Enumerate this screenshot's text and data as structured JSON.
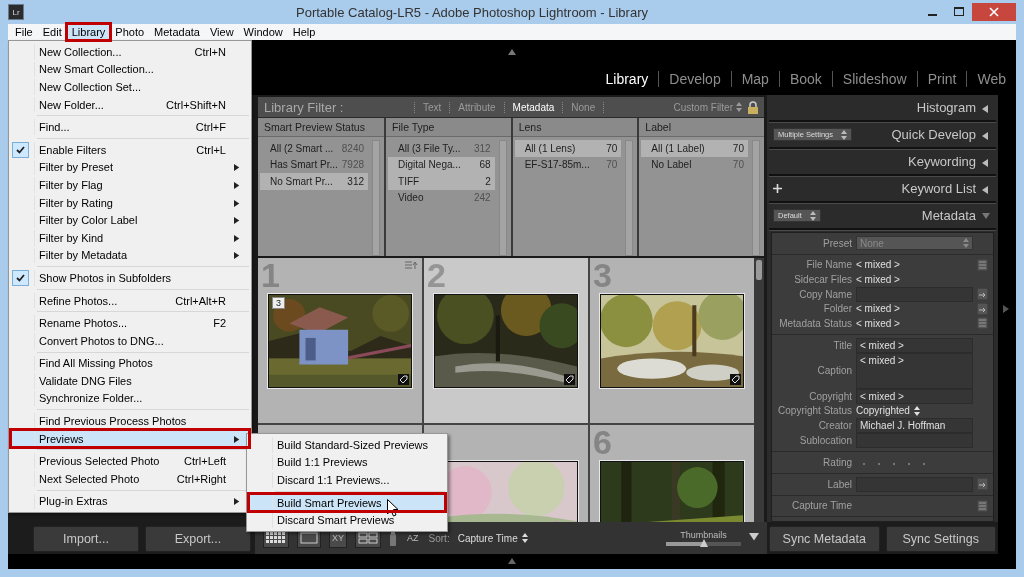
{
  "window": {
    "title": "Portable Catalog-LR5 - Adobe Photoshop Lightroom - Library",
    "app_badge": "Lr"
  },
  "menu_bar": [
    {
      "label": "File",
      "selected": false,
      "highlighted": false
    },
    {
      "label": "Edit",
      "selected": false,
      "highlighted": false
    },
    {
      "label": "Library",
      "selected": true,
      "highlighted": true
    },
    {
      "label": "Photo",
      "selected": false,
      "highlighted": false
    },
    {
      "label": "Metadata",
      "selected": false,
      "highlighted": false
    },
    {
      "label": "View",
      "selected": false,
      "highlighted": false
    },
    {
      "label": "Window",
      "selected": false,
      "highlighted": false
    },
    {
      "label": "Help",
      "selected": false,
      "highlighted": false
    }
  ],
  "modules": [
    {
      "label": "Library",
      "selected": true
    },
    {
      "label": "Develop",
      "selected": false
    },
    {
      "label": "Map",
      "selected": false
    },
    {
      "label": "Book",
      "selected": false
    },
    {
      "label": "Slideshow",
      "selected": false
    },
    {
      "label": "Print",
      "selected": false
    },
    {
      "label": "Web",
      "selected": false
    }
  ],
  "library_menu": [
    {
      "kind": "item",
      "label": "New Collection...",
      "shortcut": "Ctrl+N",
      "checked": false,
      "submenu": false,
      "selected": false,
      "highlighted": false
    },
    {
      "kind": "item",
      "label": "New Smart Collection...",
      "checked": false,
      "submenu": false,
      "selected": false,
      "highlighted": false
    },
    {
      "kind": "item",
      "label": "New Collection Set...",
      "checked": false,
      "submenu": false,
      "selected": false,
      "highlighted": false
    },
    {
      "kind": "item",
      "label": "New Folder...",
      "shortcut": "Ctrl+Shift+N",
      "checked": false,
      "submenu": false,
      "selected": false,
      "highlighted": false
    },
    {
      "kind": "separator"
    },
    {
      "kind": "item",
      "label": "Find...",
      "shortcut": "Ctrl+F",
      "checked": false,
      "submenu": false,
      "selected": false,
      "highlighted": false
    },
    {
      "kind": "separator"
    },
    {
      "kind": "item",
      "label": "Enable Filters",
      "shortcut": "Ctrl+L",
      "checked": true,
      "submenu": false,
      "selected": false,
      "highlighted": false
    },
    {
      "kind": "item",
      "label": "Filter by Preset",
      "checked": false,
      "submenu": true,
      "selected": false,
      "highlighted": false
    },
    {
      "kind": "item",
      "label": "Filter by Flag",
      "checked": false,
      "submenu": true,
      "selected": false,
      "highlighted": false
    },
    {
      "kind": "item",
      "label": "Filter by Rating",
      "checked": false,
      "submenu": true,
      "selected": false,
      "highlighted": false
    },
    {
      "kind": "item",
      "label": "Filter by Color Label",
      "checked": false,
      "submenu": true,
      "selected": false,
      "highlighted": false
    },
    {
      "kind": "item",
      "label": "Filter by Kind",
      "checked": false,
      "submenu": true,
      "selected": false,
      "highlighted": false
    },
    {
      "kind": "item",
      "label": "Filter by Metadata",
      "checked": false,
      "submenu": true,
      "selected": false,
      "highlighted": false
    },
    {
      "kind": "separator"
    },
    {
      "kind": "item",
      "label": "Show Photos in Subfolders",
      "checked": true,
      "submenu": false,
      "selected": false,
      "highlighted": false
    },
    {
      "kind": "separator"
    },
    {
      "kind": "item",
      "label": "Refine Photos...",
      "shortcut": "Ctrl+Alt+R",
      "checked": false,
      "submenu": false,
      "selected": false,
      "highlighted": false
    },
    {
      "kind": "separator"
    },
    {
      "kind": "item",
      "label": "Rename Photos...",
      "shortcut": "F2",
      "checked": false,
      "submenu": false,
      "selected": false,
      "highlighted": false
    },
    {
      "kind": "item",
      "label": "Convert Photos to DNG...",
      "checked": false,
      "submenu": false,
      "selected": false,
      "highlighted": false
    },
    {
      "kind": "separator"
    },
    {
      "kind": "item",
      "label": "Find All Missing Photos",
      "checked": false,
      "submenu": false,
      "selected": false,
      "highlighted": false
    },
    {
      "kind": "item",
      "label": "Validate DNG Files",
      "checked": false,
      "submenu": false,
      "selected": false,
      "highlighted": false
    },
    {
      "kind": "item",
      "label": "Synchronize Folder...",
      "checked": false,
      "submenu": false,
      "selected": false,
      "highlighted": false
    },
    {
      "kind": "separator"
    },
    {
      "kind": "item",
      "label": "Find Previous Process Photos",
      "checked": false,
      "submenu": false,
      "selected": false,
      "highlighted": false
    },
    {
      "kind": "item",
      "label": "Previews",
      "checked": false,
      "submenu": true,
      "selected": true,
      "highlighted": true
    },
    {
      "kind": "separator"
    },
    {
      "kind": "item",
      "label": "Previous Selected Photo",
      "shortcut": "Ctrl+Left",
      "checked": false,
      "submenu": false,
      "selected": false,
      "highlighted": false
    },
    {
      "kind": "item",
      "label": "Next Selected Photo",
      "shortcut": "Ctrl+Right",
      "checked": false,
      "submenu": false,
      "selected": false,
      "highlighted": false
    },
    {
      "kind": "separator"
    },
    {
      "kind": "item",
      "label": "Plug-in Extras",
      "checked": false,
      "submenu": true,
      "selected": false,
      "highlighted": false
    }
  ],
  "previews_submenu": [
    {
      "kind": "item",
      "label": "Build Standard-Sized Previews",
      "selected": false,
      "highlighted": false
    },
    {
      "kind": "item",
      "label": "Build 1:1 Previews",
      "selected": false,
      "highlighted": false
    },
    {
      "kind": "item",
      "label": "Discard 1:1 Previews...",
      "selected": false,
      "highlighted": false
    },
    {
      "kind": "separator"
    },
    {
      "kind": "item",
      "label": "Build Smart Previews",
      "selected": true,
      "highlighted": true
    },
    {
      "kind": "item",
      "label": "Discard Smart Previews",
      "selected": false,
      "highlighted": false
    }
  ],
  "filter_bar": {
    "title": "Library Filter :",
    "tabs": [
      {
        "label": "Text",
        "selected": false
      },
      {
        "label": "Attribute",
        "selected": false
      },
      {
        "label": "Metadata",
        "selected": true
      },
      {
        "label": "None",
        "selected": false
      }
    ],
    "preset": "Custom Filter"
  },
  "filter_columns": [
    {
      "header": "Smart Preview Status",
      "rows": [
        {
          "label": "All (2 Smart ...",
          "count": "8240",
          "selected": false
        },
        {
          "label": "Has Smart Pr...",
          "count": "7928",
          "selected": false
        },
        {
          "label": "No Smart Pr...",
          "count": "312",
          "selected": true
        }
      ]
    },
    {
      "header": "File Type",
      "rows": [
        {
          "label": "All (3 File Ty...",
          "count": "312",
          "selected": false
        },
        {
          "label": "Digital Nega...",
          "count": "68",
          "selected": true
        },
        {
          "label": "TIFF",
          "count": "2",
          "selected": true
        },
        {
          "label": "Video",
          "count": "242",
          "selected": false
        }
      ]
    },
    {
      "header": "Lens",
      "rows": [
        {
          "label": "All (1 Lens)",
          "count": "70",
          "selected": true
        },
        {
          "label": "EF-S17-85m...",
          "count": "70",
          "selected": false
        }
      ]
    },
    {
      "header": "Label",
      "rows": [
        {
          "label": "All (1 Label)",
          "count": "70",
          "selected": true
        },
        {
          "label": "No Label",
          "count": "70",
          "selected": false
        }
      ]
    }
  ],
  "grid": {
    "cells": [
      {
        "number": "1",
        "selected": false,
        "badge": "3",
        "kind": "picture"
      },
      {
        "number": "2",
        "selected": true,
        "kind": "picture"
      },
      {
        "number": "3",
        "selected": false,
        "kind": "picture"
      },
      {
        "selected": false,
        "kind": "empty"
      },
      {
        "selected": false,
        "kind": "picture"
      },
      {
        "number": "6",
        "selected": false,
        "kind": "picture"
      }
    ]
  },
  "right_panel": {
    "sections": [
      {
        "title": "Histogram",
        "kind": "plain",
        "expanded": false
      },
      {
        "title": "Quick Develop",
        "kind": "select",
        "select": "Multiple Settings",
        "expanded": false
      },
      {
        "title": "Keywording",
        "kind": "plain",
        "expanded": false
      },
      {
        "title": "Keyword List",
        "kind": "add",
        "expanded": false
      },
      {
        "title": "Metadata",
        "kind": "select",
        "select": "Default",
        "expanded": true
      }
    ],
    "metadata_groups": [
      {
        "fields": [
          {
            "label": "Preset",
            "kind": "select",
            "value": "None"
          }
        ]
      },
      {
        "fields": [
          {
            "label": "File Name",
            "kind": "text",
            "value": "< mixed >",
            "list_button": true
          },
          {
            "label": "Sidecar Files",
            "kind": "text",
            "value": "< mixed >"
          },
          {
            "label": "Copy Name",
            "kind": "field",
            "arrow_button": true
          },
          {
            "label": "Folder",
            "kind": "text",
            "value": "< mixed >",
            "arrow_button": true
          },
          {
            "label": "Metadata Status",
            "kind": "text",
            "value": "< mixed >",
            "list_button": true
          }
        ]
      },
      {
        "fields": [
          {
            "label": "Title",
            "kind": "field",
            "value": "< mixed >"
          },
          {
            "label": "Caption",
            "kind": "tall",
            "value": "< mixed >"
          },
          {
            "label": "Copyright",
            "kind": "field",
            "value": "< mixed >"
          },
          {
            "label": "Copyright Status",
            "kind": "menu",
            "value": "Copyrighted"
          },
          {
            "label": "Creator",
            "kind": "field",
            "value": "Michael J. Hoffman"
          },
          {
            "label": "Sublocation",
            "kind": "field"
          }
        ]
      },
      {
        "fields": [
          {
            "label": "Rating",
            "kind": "rating",
            "stars": 0
          }
        ]
      },
      {
        "fields": [
          {
            "label": "Label",
            "kind": "field",
            "arrow_button": true
          }
        ]
      },
      {
        "fields": [
          {
            "label": "Capture Time",
            "kind": "text",
            "list_button": true
          }
        ]
      }
    ]
  },
  "toolbar": {
    "compare_letters": [
      "X",
      "Y"
    ],
    "sort_letters": [
      "A",
      "Z"
    ],
    "sort_label": "Sort:",
    "sort_value": "Capture Time",
    "thumbnails_label": "Thumbnails",
    "thumbnail_slider": {
      "level": 0.5
    }
  },
  "left_buttons": [
    "Import...",
    "Export..."
  ],
  "right_buttons": [
    "Sync Metadata",
    "Sync Settings"
  ]
}
